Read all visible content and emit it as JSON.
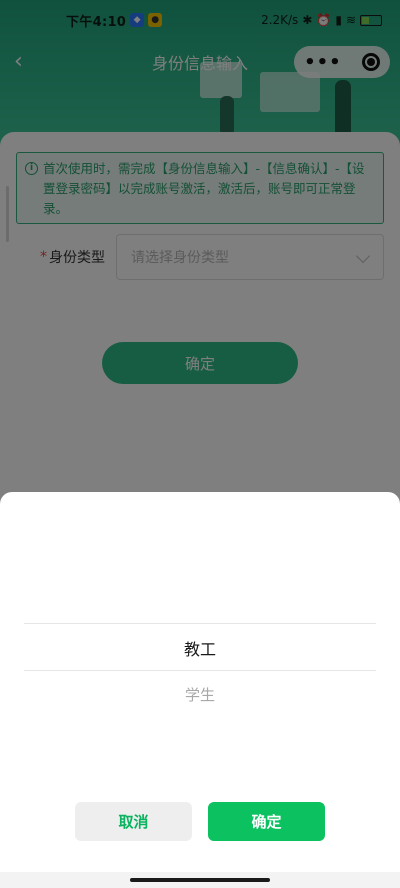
{
  "status_bar": {
    "time": "下午4:10",
    "network_speed": "2.2K/s",
    "battery_level": "48"
  },
  "nav": {
    "title": "身份信息输入",
    "back_icon": "chevron-left-icon",
    "more_icon": "more-dots-icon",
    "close_icon": "target-circle-icon"
  },
  "notice": {
    "text": "首次使用时，需完成【身份信息输入】-【信息确认】-【设置登录密码】以完成账号激活，激活后，账号即可正常登录。",
    "icon": "info-icon"
  },
  "form": {
    "identity_label": "身份类型",
    "required_mark": "*",
    "identity_placeholder": "请选择身份类型",
    "confirm_label": "确定"
  },
  "picker": {
    "options": [
      "教工",
      "学生"
    ],
    "selected_index": 0,
    "cancel_label": "取消",
    "ok_label": "确定"
  },
  "colors": {
    "brand_green": "#0bc160",
    "header_green": "#1fa37b",
    "notice_green": "#29a16f"
  }
}
